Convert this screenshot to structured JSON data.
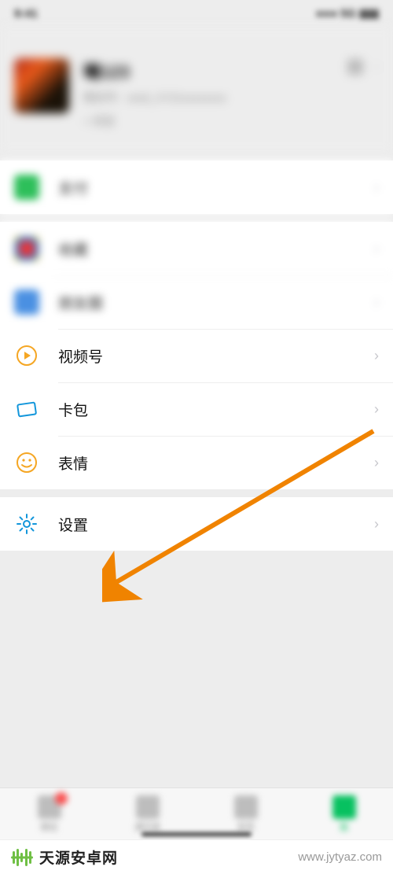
{
  "status": {
    "time": "9:41",
    "right": "●●● 5G ▮▮▮"
  },
  "profile": {
    "name": "曦123",
    "sub": "微信号：wxid_XYZxxxxxxxxx",
    "status": "+ 状态"
  },
  "rows": {
    "pay": "支付",
    "favorites": "收藏",
    "moments": "朋友圈",
    "channels": "视频号",
    "cards": "卡包",
    "emoji": "表情",
    "settings": "设置"
  },
  "tabs": {
    "chat": "微信",
    "contacts": "通讯录",
    "discover": "发现",
    "me": "我"
  },
  "watermark": {
    "brand": "天源安卓网",
    "url": "www.jytyaz.com"
  },
  "colors": {
    "accent": "#07c160",
    "video_icon": "#f5a623",
    "card_icon": "#1296db",
    "emoji_icon": "#f5a623",
    "settings_icon": "#1296db",
    "arrow": "#f08300"
  }
}
